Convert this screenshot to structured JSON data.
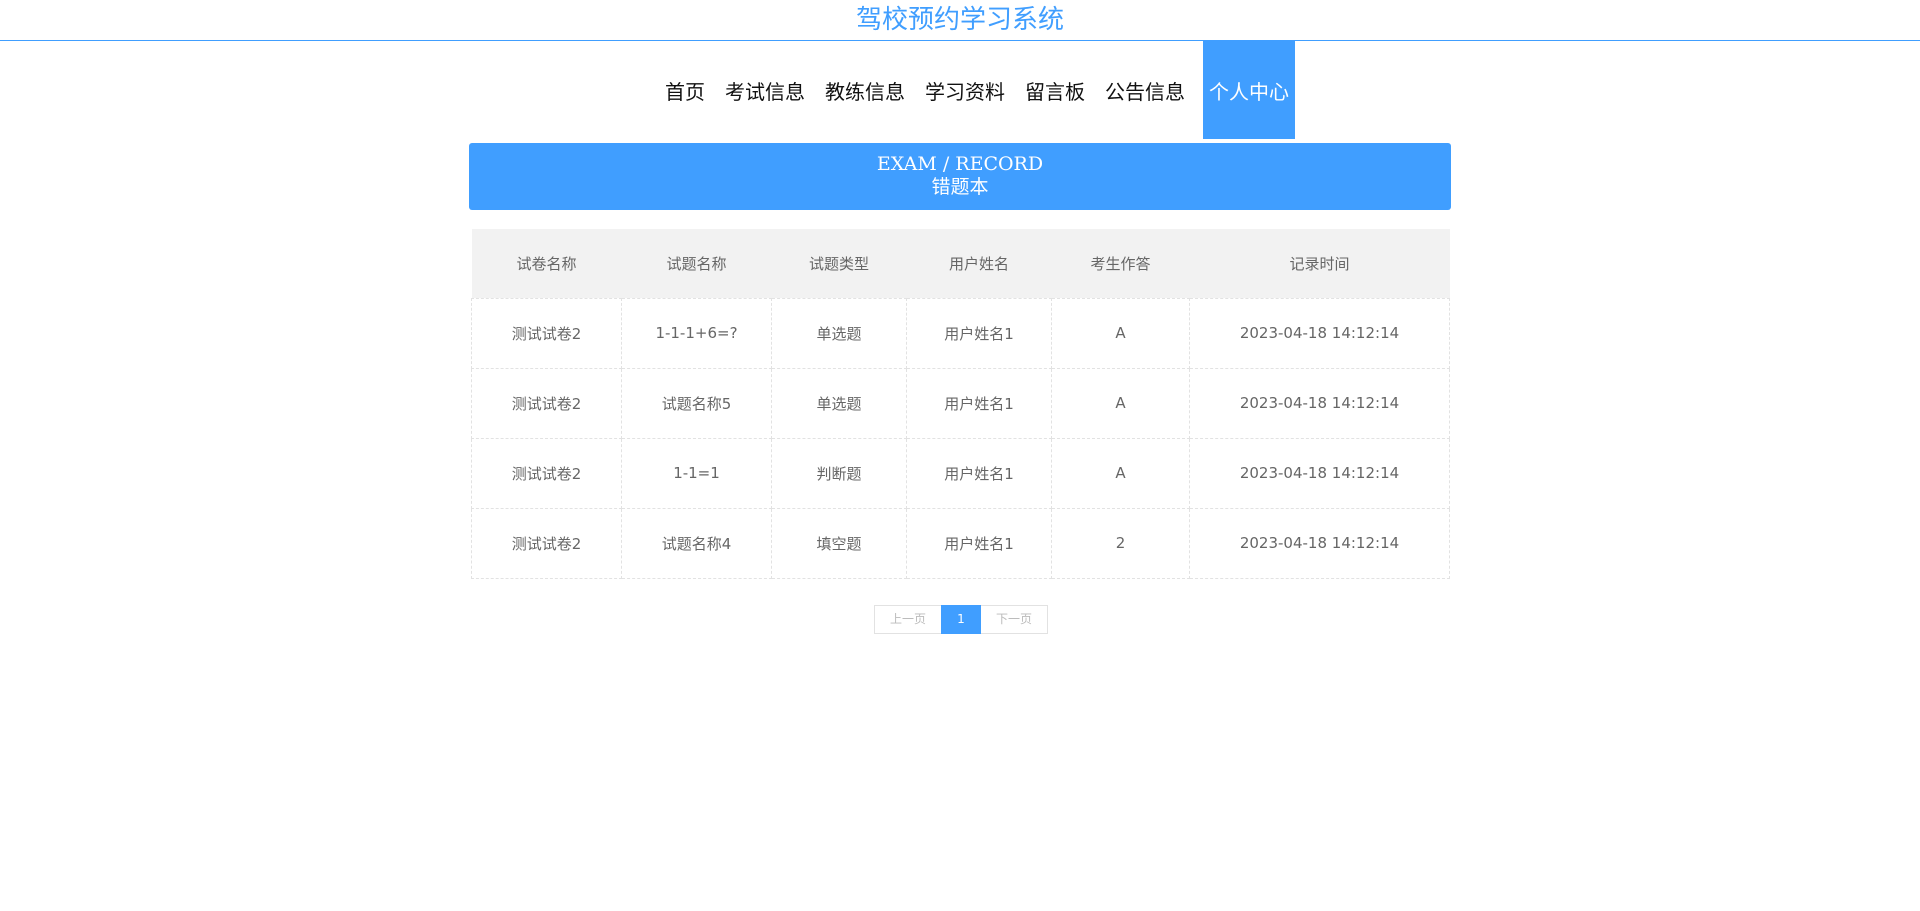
{
  "header": {
    "site_title": "驾校预约学习系统"
  },
  "nav": {
    "items": [
      {
        "label": "首页"
      },
      {
        "label": "考试信息"
      },
      {
        "label": "教练信息"
      },
      {
        "label": "学习资料"
      },
      {
        "label": "留言板"
      },
      {
        "label": "公告信息"
      },
      {
        "label": "个人中心",
        "active": true
      }
    ]
  },
  "banner": {
    "en_title": "EXAM / RECORD",
    "cn_title": "错题本"
  },
  "table": {
    "columns": [
      "试卷名称",
      "试题名称",
      "试题类型",
      "用户姓名",
      "考生作答",
      "记录时间"
    ],
    "rows": [
      [
        "测试试卷2",
        "1-1-1+6=?",
        "单选题",
        "用户姓名1",
        "A",
        "2023-04-18 14:12:14"
      ],
      [
        "测试试卷2",
        "试题名称5",
        "单选题",
        "用户姓名1",
        "A",
        "2023-04-18 14:12:14"
      ],
      [
        "测试试卷2",
        "1-1=1",
        "判断题",
        "用户姓名1",
        "A",
        "2023-04-18 14:12:14"
      ],
      [
        "测试试卷2",
        "试题名称4",
        "填空题",
        "用户姓名1",
        "2",
        "2023-04-18 14:12:14"
      ]
    ]
  },
  "pagination": {
    "prev_label": "上一页",
    "current_page": "1",
    "next_label": "下一页"
  },
  "colors": {
    "accent": "#409eff",
    "header_bg": "#f2f2f2",
    "text_muted": "#666666"
  }
}
